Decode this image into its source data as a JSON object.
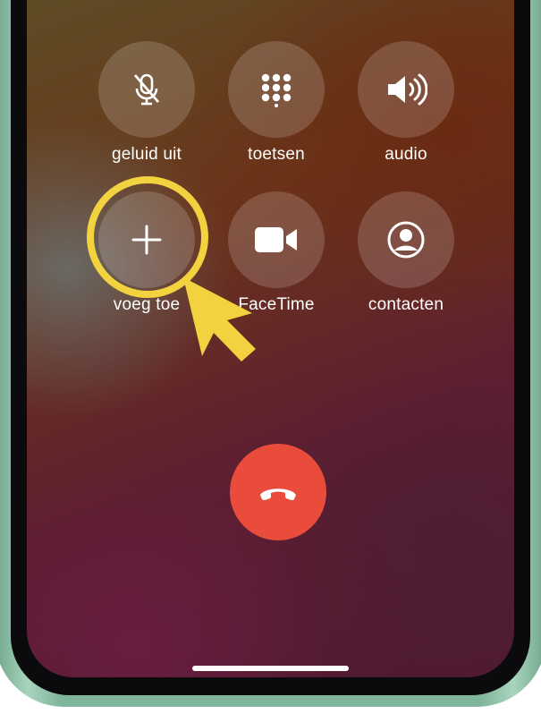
{
  "call_controls": {
    "mute_label": "geluid uit",
    "keypad_label": "toetsen",
    "audio_label": "audio",
    "add_call_label": "voeg toe",
    "facetime_label": "FaceTime",
    "contacts_label": "contacten"
  },
  "icons": {
    "mute": "microphone-slash-icon",
    "keypad": "keypad-grid-icon",
    "audio": "speaker-icon",
    "add_call": "plus-icon",
    "facetime": "video-camera-icon",
    "contacts": "contact-person-icon",
    "end_call": "phone-hangup-icon"
  },
  "colors": {
    "end_call": "#ea4c3c",
    "highlight": "#f2d23f",
    "frame": "#7fb59b"
  }
}
